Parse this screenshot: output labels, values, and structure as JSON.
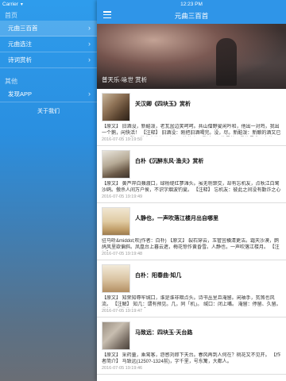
{
  "drawer": {
    "status_carrier": "Carrier",
    "sections": [
      {
        "header": "首页",
        "items": [
          {
            "label": "元曲三百首",
            "active": true
          },
          {
            "label": "元曲选注",
            "active": false
          },
          {
            "label": "诗词赏析",
            "active": false
          }
        ]
      },
      {
        "header": "其他",
        "items": [
          {
            "label": "发现APP",
            "active": false
          }
        ]
      }
    ],
    "about": "关于我们"
  },
  "main": {
    "status_carrier": "Carrier",
    "status_time": "12:23 PM",
    "title": "元曲三百首",
    "banner_caption": "普天乐·咏世 赏析",
    "articles": [
      {
        "title": "关汉卿《四块玉》赏析",
        "excerpt": "【原文】    旧酒没，新醅泼，老瓦盆边笑呵呵。共山僧野叟闲吟和，他出一对鸡，我出一个鹅，闲快活！ 【注释】    旧酒没：刚把旧酒喝完。没，尽。新醅泼：新酿的酒又已经酿好。泼，酸。世态人情经历多，闲将往事思量过，贤的是他，愚的是我，争什",
        "date": "2016-07-05 19:19:50"
      },
      {
        "title": "白朴《沉醉东风·渔夫》赏析",
        "excerpt": "【原文】    黄芦岸白蘋渡口，绿杨堤红蓼滩头。虽无刎颈交，却有忘机友，点秋江白鹭沙鸥。傲杀人间万户侯，不识字烟波钓叟。    【注释】    忘机友：彼此之间没有勤诈之心无",
        "date": "2016-07-05 19:19:49"
      },
      {
        "title": "人静也，一声吹落江楼月出自哪里",
        "excerpt": "驻马听&middot;吹(作者：白朴)    【原文】    裂石穿云，玉管宜横清更洁。霜天沙漠，鹧鸪风里欲偏斜。凤凰台上暮云遮，梅花惊作黄昏雪。人静也，一声吹落江楼月。    【注解】",
        "date": "2016-07-05 19:19:48"
      },
      {
        "title": "白朴：阳春曲·知几",
        "excerpt": "【原文】    知荣知辱牢缄口，谁是谁非暗点头。诗书丛里且淹留。闲袖手，贫煞也风流。 【注解】    知几：谓有预见。几，同「机」。    缄口：闭上嘴。    淹留：停留、久留。    贫煞：非常贫穷。    【",
        "date": "2016-07-05 19:19:47"
      },
      {
        "title": "马致远：四块玉·天台路",
        "excerpt": "【原文】    采药童，乘鸾客，怨感刘郎下天台。春风再到人何在？桃花又不见开。 【作者简介】    马致远(1250?-1324前)，字千里，号东篱，大都人。",
        "date": "2016-07-05 19:19:46"
      }
    ]
  }
}
